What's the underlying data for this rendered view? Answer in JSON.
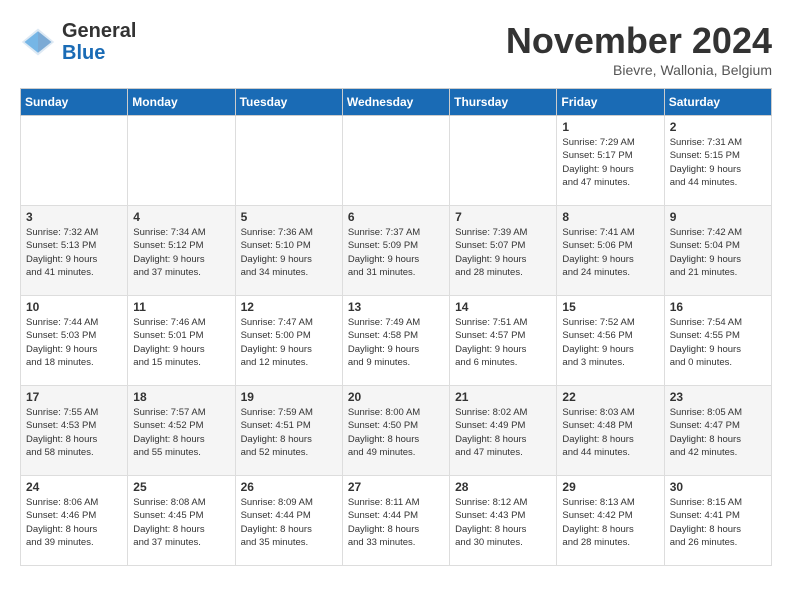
{
  "logo": {
    "text_general": "General",
    "text_blue": "Blue"
  },
  "title": "November 2024",
  "location": "Bievre, Wallonia, Belgium",
  "days_of_week": [
    "Sunday",
    "Monday",
    "Tuesday",
    "Wednesday",
    "Thursday",
    "Friday",
    "Saturday"
  ],
  "weeks": [
    [
      {
        "day": "",
        "info": ""
      },
      {
        "day": "",
        "info": ""
      },
      {
        "day": "",
        "info": ""
      },
      {
        "day": "",
        "info": ""
      },
      {
        "day": "",
        "info": ""
      },
      {
        "day": "1",
        "info": "Sunrise: 7:29 AM\nSunset: 5:17 PM\nDaylight: 9 hours\nand 47 minutes."
      },
      {
        "day": "2",
        "info": "Sunrise: 7:31 AM\nSunset: 5:15 PM\nDaylight: 9 hours\nand 44 minutes."
      }
    ],
    [
      {
        "day": "3",
        "info": "Sunrise: 7:32 AM\nSunset: 5:13 PM\nDaylight: 9 hours\nand 41 minutes."
      },
      {
        "day": "4",
        "info": "Sunrise: 7:34 AM\nSunset: 5:12 PM\nDaylight: 9 hours\nand 37 minutes."
      },
      {
        "day": "5",
        "info": "Sunrise: 7:36 AM\nSunset: 5:10 PM\nDaylight: 9 hours\nand 34 minutes."
      },
      {
        "day": "6",
        "info": "Sunrise: 7:37 AM\nSunset: 5:09 PM\nDaylight: 9 hours\nand 31 minutes."
      },
      {
        "day": "7",
        "info": "Sunrise: 7:39 AM\nSunset: 5:07 PM\nDaylight: 9 hours\nand 28 minutes."
      },
      {
        "day": "8",
        "info": "Sunrise: 7:41 AM\nSunset: 5:06 PM\nDaylight: 9 hours\nand 24 minutes."
      },
      {
        "day": "9",
        "info": "Sunrise: 7:42 AM\nSunset: 5:04 PM\nDaylight: 9 hours\nand 21 minutes."
      }
    ],
    [
      {
        "day": "10",
        "info": "Sunrise: 7:44 AM\nSunset: 5:03 PM\nDaylight: 9 hours\nand 18 minutes."
      },
      {
        "day": "11",
        "info": "Sunrise: 7:46 AM\nSunset: 5:01 PM\nDaylight: 9 hours\nand 15 minutes."
      },
      {
        "day": "12",
        "info": "Sunrise: 7:47 AM\nSunset: 5:00 PM\nDaylight: 9 hours\nand 12 minutes."
      },
      {
        "day": "13",
        "info": "Sunrise: 7:49 AM\nSunset: 4:58 PM\nDaylight: 9 hours\nand 9 minutes."
      },
      {
        "day": "14",
        "info": "Sunrise: 7:51 AM\nSunset: 4:57 PM\nDaylight: 9 hours\nand 6 minutes."
      },
      {
        "day": "15",
        "info": "Sunrise: 7:52 AM\nSunset: 4:56 PM\nDaylight: 9 hours\nand 3 minutes."
      },
      {
        "day": "16",
        "info": "Sunrise: 7:54 AM\nSunset: 4:55 PM\nDaylight: 9 hours\nand 0 minutes."
      }
    ],
    [
      {
        "day": "17",
        "info": "Sunrise: 7:55 AM\nSunset: 4:53 PM\nDaylight: 8 hours\nand 58 minutes."
      },
      {
        "day": "18",
        "info": "Sunrise: 7:57 AM\nSunset: 4:52 PM\nDaylight: 8 hours\nand 55 minutes."
      },
      {
        "day": "19",
        "info": "Sunrise: 7:59 AM\nSunset: 4:51 PM\nDaylight: 8 hours\nand 52 minutes."
      },
      {
        "day": "20",
        "info": "Sunrise: 8:00 AM\nSunset: 4:50 PM\nDaylight: 8 hours\nand 49 minutes."
      },
      {
        "day": "21",
        "info": "Sunrise: 8:02 AM\nSunset: 4:49 PM\nDaylight: 8 hours\nand 47 minutes."
      },
      {
        "day": "22",
        "info": "Sunrise: 8:03 AM\nSunset: 4:48 PM\nDaylight: 8 hours\nand 44 minutes."
      },
      {
        "day": "23",
        "info": "Sunrise: 8:05 AM\nSunset: 4:47 PM\nDaylight: 8 hours\nand 42 minutes."
      }
    ],
    [
      {
        "day": "24",
        "info": "Sunrise: 8:06 AM\nSunset: 4:46 PM\nDaylight: 8 hours\nand 39 minutes."
      },
      {
        "day": "25",
        "info": "Sunrise: 8:08 AM\nSunset: 4:45 PM\nDaylight: 8 hours\nand 37 minutes."
      },
      {
        "day": "26",
        "info": "Sunrise: 8:09 AM\nSunset: 4:44 PM\nDaylight: 8 hours\nand 35 minutes."
      },
      {
        "day": "27",
        "info": "Sunrise: 8:11 AM\nSunset: 4:44 PM\nDaylight: 8 hours\nand 33 minutes."
      },
      {
        "day": "28",
        "info": "Sunrise: 8:12 AM\nSunset: 4:43 PM\nDaylight: 8 hours\nand 30 minutes."
      },
      {
        "day": "29",
        "info": "Sunrise: 8:13 AM\nSunset: 4:42 PM\nDaylight: 8 hours\nand 28 minutes."
      },
      {
        "day": "30",
        "info": "Sunrise: 8:15 AM\nSunset: 4:41 PM\nDaylight: 8 hours\nand 26 minutes."
      }
    ]
  ]
}
